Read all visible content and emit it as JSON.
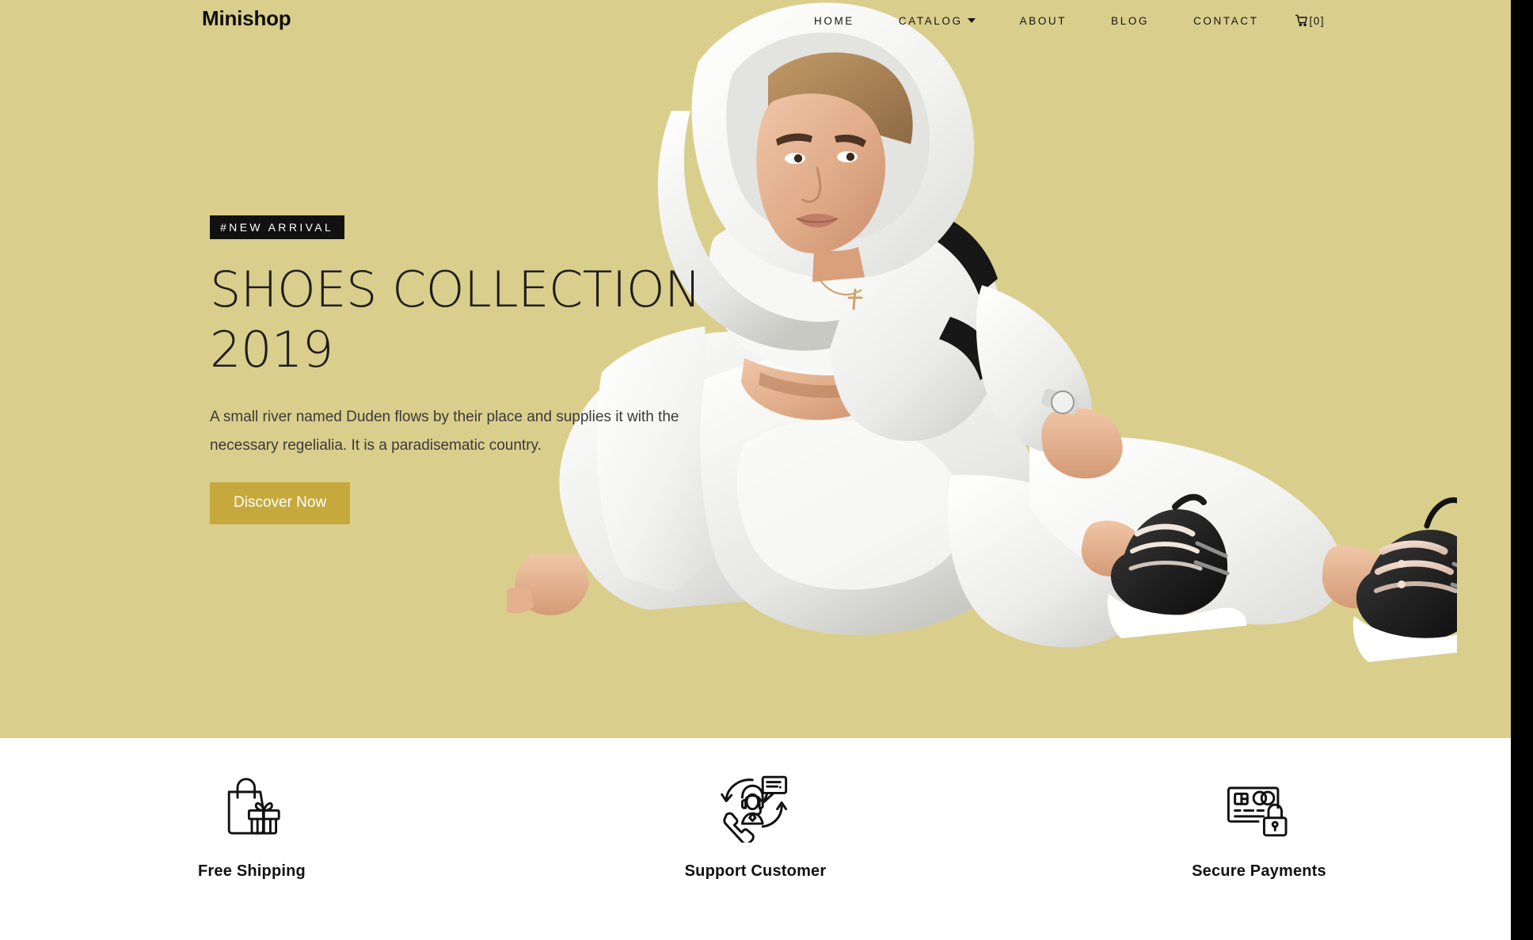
{
  "site": {
    "brand": "Minishop",
    "theme": {
      "hero_bg": "#DACE8C",
      "button_bg": "#C5A93C",
      "badge_bg": "#111111",
      "text_dark": "#1D1D1D",
      "page_bg": "#FFFFFF",
      "edge_strip": "#000000"
    }
  },
  "nav": {
    "items": [
      {
        "label": "HOME",
        "has_caret": false,
        "icon": ""
      },
      {
        "label": "CATALOG",
        "has_caret": true,
        "icon": "chevron-down-icon"
      },
      {
        "label": "ABOUT",
        "has_caret": false,
        "icon": ""
      },
      {
        "label": "BLOG",
        "has_caret": false,
        "icon": ""
      },
      {
        "label": "CONTACT",
        "has_caret": false,
        "icon": ""
      }
    ],
    "cart": {
      "icon": "shopping-cart-icon",
      "label": "[0]",
      "count": 0
    }
  },
  "hero": {
    "badge": "#NEW ARRIVAL",
    "title": "SHOES COLLECTION 2019",
    "description": "A small river named Duden flows by their place and supplies it with the necessary regelialia. It is a paradisematic country.",
    "cta_label": "Discover Now",
    "image_alt": "Woman in white hoodie and tracksuit sitting, wearing sneakers"
  },
  "features": [
    {
      "icon": "shopping-bag-gift-icon",
      "label": "Free Shipping"
    },
    {
      "icon": "customer-support-headset-icon",
      "label": "Support Customer"
    },
    {
      "icon": "credit-card-lock-icon",
      "label": "Secure Payments"
    }
  ]
}
